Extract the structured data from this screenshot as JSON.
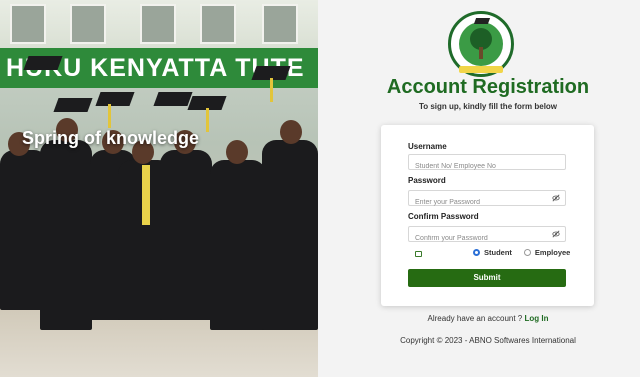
{
  "hero": {
    "banner_text": "HUKU KENYATTA TUTE",
    "slogan": "Spring of knowledge"
  },
  "logo": {
    "icon": "university-crest-icon"
  },
  "header": {
    "title": "Account Registration",
    "subtitle": "To sign up, kindly fill the form below"
  },
  "form": {
    "username_label": "Username",
    "username_placeholder": "Student No/ Employee No",
    "username_value": "",
    "password_label": "Password",
    "password_placeholder": "Enter your Password",
    "password_value": "",
    "confirm_label": "Confirm Password",
    "confirm_placeholder": "Confirm your Password",
    "confirm_value": "",
    "roles": [
      "Student",
      "Employee"
    ],
    "selected_role": "Student",
    "submit_label": "Submit"
  },
  "footer": {
    "already_text": "Already have an account ?",
    "login_link": "Log In",
    "copyright": "Copyright © 2023 - ABNO Softwares International"
  },
  "colors": {
    "brand_green": "#1f6b22",
    "button_green": "#266b12",
    "radio_blue": "#2a6fd6"
  }
}
